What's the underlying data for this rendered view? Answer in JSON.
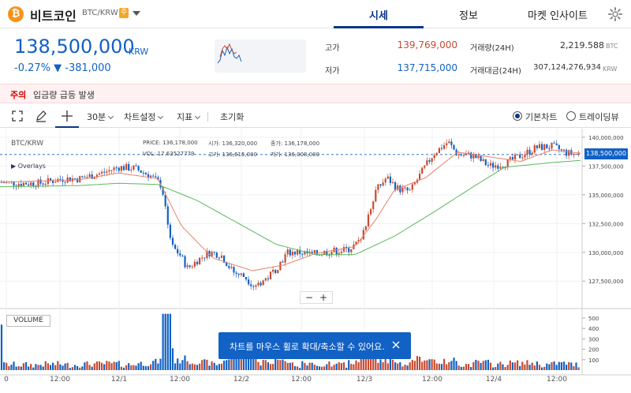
{
  "header": {
    "coin_symbol": "₿",
    "coin_name": "비트코인",
    "pair": "BTC/KRW",
    "warn_badge": "주",
    "tabs": [
      {
        "label": "시세",
        "active": true
      },
      {
        "label": "정보",
        "active": false
      },
      {
        "label": "마켓 인사이트",
        "active": false
      }
    ],
    "settings_icon": "gear-icon"
  },
  "price": {
    "value": "138,500,000",
    "unit": "KRW",
    "change": "-0.27% ▼ -381,000"
  },
  "stats": {
    "high_label": "고가",
    "high_value": "139,769,000",
    "low_label": "저가",
    "low_value": "137,715,000",
    "vol_label": "거래량(24H)",
    "vol_value": "2,219.588",
    "vol_unit": "BTC",
    "amt_label": "거래대금(24H)",
    "amt_value": "307,124,276,934",
    "amt_unit": "KRW"
  },
  "notice": {
    "tag": "주의",
    "text": "입금량 급등 발생"
  },
  "toolbar": {
    "fullscreen_icon": "fullscreen-icon",
    "draw_icon": "pencil-icon",
    "crosshair_icon": "crosshair-icon",
    "interval": "30분",
    "chart_settings": "차트설정",
    "indicators": "지표",
    "reset": "초기화",
    "basic_chart": "기본차트",
    "tradingview": "트레이딩뷰"
  },
  "chart": {
    "symbol": "BTC/KRW",
    "overlays": "▶ Overlays",
    "legend": {
      "price_label": "PRICE:",
      "price_value": "136,178,000",
      "open_label": "시가:",
      "open_value": "136,320,000",
      "close_label": "종가:",
      "close_value": "136,178,000",
      "vol_label": "VOL:",
      "vol_value": "17.63527779",
      "high_label": "고가:",
      "high_value": "136,615,000",
      "low_label": "저가:",
      "low_value": "136,008,000"
    },
    "current_price_tag": "138,500,000",
    "zoom_minus": "−",
    "zoom_plus": "+",
    "volume_label": "VOLUME",
    "toast": "차트를 마우스 휠로 확대/축소할 수 있어요.",
    "colors": {
      "up": "#c84a31",
      "down": "#1261c4",
      "ma_short": "#e8826d",
      "ma_long": "#5cb85c"
    }
  },
  "chart_data": {
    "type": "candlestick",
    "y_ticks": [
      "140,000,000",
      "137,500,000",
      "135,000,000",
      "132,500,000",
      "130,000,000",
      "127,500,000"
    ],
    "ylim": [
      125800000,
      140200000
    ],
    "volume_ticks": [
      "500",
      "400",
      "300",
      "200",
      "100"
    ],
    "volume_ylim": [
      0,
      560
    ],
    "x_ticks": [
      "0",
      "12:00",
      "12/1",
      "12:00",
      "12/2",
      "12:00",
      "12/3",
      "12:00",
      "12/4",
      "12:00"
    ],
    "anchors": [
      [
        0,
        136100000
      ],
      [
        20,
        136000000
      ],
      [
        50,
        136000000
      ],
      [
        80,
        136400000
      ],
      [
        100,
        136400000
      ],
      [
        130,
        136900000
      ],
      [
        150,
        137400000
      ],
      [
        170,
        137300000
      ],
      [
        190,
        136700000
      ],
      [
        205,
        135800000
      ],
      [
        212,
        133000000
      ],
      [
        218,
        130500000
      ],
      [
        228,
        129800000
      ],
      [
        238,
        128600000
      ],
      [
        250,
        129300000
      ],
      [
        265,
        130000000
      ],
      [
        280,
        129800000
      ],
      [
        295,
        128300000
      ],
      [
        310,
        127900000
      ],
      [
        322,
        127100000
      ],
      [
        338,
        127700000
      ],
      [
        350,
        128600000
      ],
      [
        365,
        130000000
      ],
      [
        380,
        130000000
      ],
      [
        395,
        129800000
      ],
      [
        420,
        130100000
      ],
      [
        440,
        130200000
      ],
      [
        458,
        131000000
      ],
      [
        465,
        132800000
      ],
      [
        475,
        135200000
      ],
      [
        490,
        136500000
      ],
      [
        505,
        135500000
      ],
      [
        520,
        135300000
      ],
      [
        535,
        137000000
      ],
      [
        550,
        138600000
      ],
      [
        568,
        139600000
      ],
      [
        580,
        138500000
      ],
      [
        600,
        138400000
      ],
      [
        620,
        137500000
      ],
      [
        640,
        137700000
      ],
      [
        660,
        138400000
      ],
      [
        680,
        139100000
      ],
      [
        700,
        139200000
      ],
      [
        720,
        138600000
      ],
      [
        738,
        138500000
      ]
    ],
    "ma_short": [
      [
        0,
        136100000
      ],
      [
        100,
        136300000
      ],
      [
        150,
        136900000
      ],
      [
        200,
        136400000
      ],
      [
        230,
        132300000
      ],
      [
        270,
        129500000
      ],
      [
        320,
        128400000
      ],
      [
        360,
        128900000
      ],
      [
        400,
        129900000
      ],
      [
        450,
        130500000
      ],
      [
        475,
        132700000
      ],
      [
        500,
        135400000
      ],
      [
        540,
        136500000
      ],
      [
        580,
        138700000
      ],
      [
        620,
        138300000
      ],
      [
        660,
        137900000
      ],
      [
        700,
        138900000
      ],
      [
        738,
        138600000
      ]
    ],
    "ma_long": [
      [
        0,
        135700000
      ],
      [
        100,
        135800000
      ],
      [
        150,
        136000000
      ],
      [
        200,
        135900000
      ],
      [
        250,
        134500000
      ],
      [
        300,
        132600000
      ],
      [
        350,
        130700000
      ],
      [
        400,
        129800000
      ],
      [
        450,
        129800000
      ],
      [
        500,
        131400000
      ],
      [
        550,
        133500000
      ],
      [
        600,
        135700000
      ],
      [
        640,
        137400000
      ],
      [
        700,
        137800000
      ],
      [
        738,
        138000000
      ]
    ]
  }
}
